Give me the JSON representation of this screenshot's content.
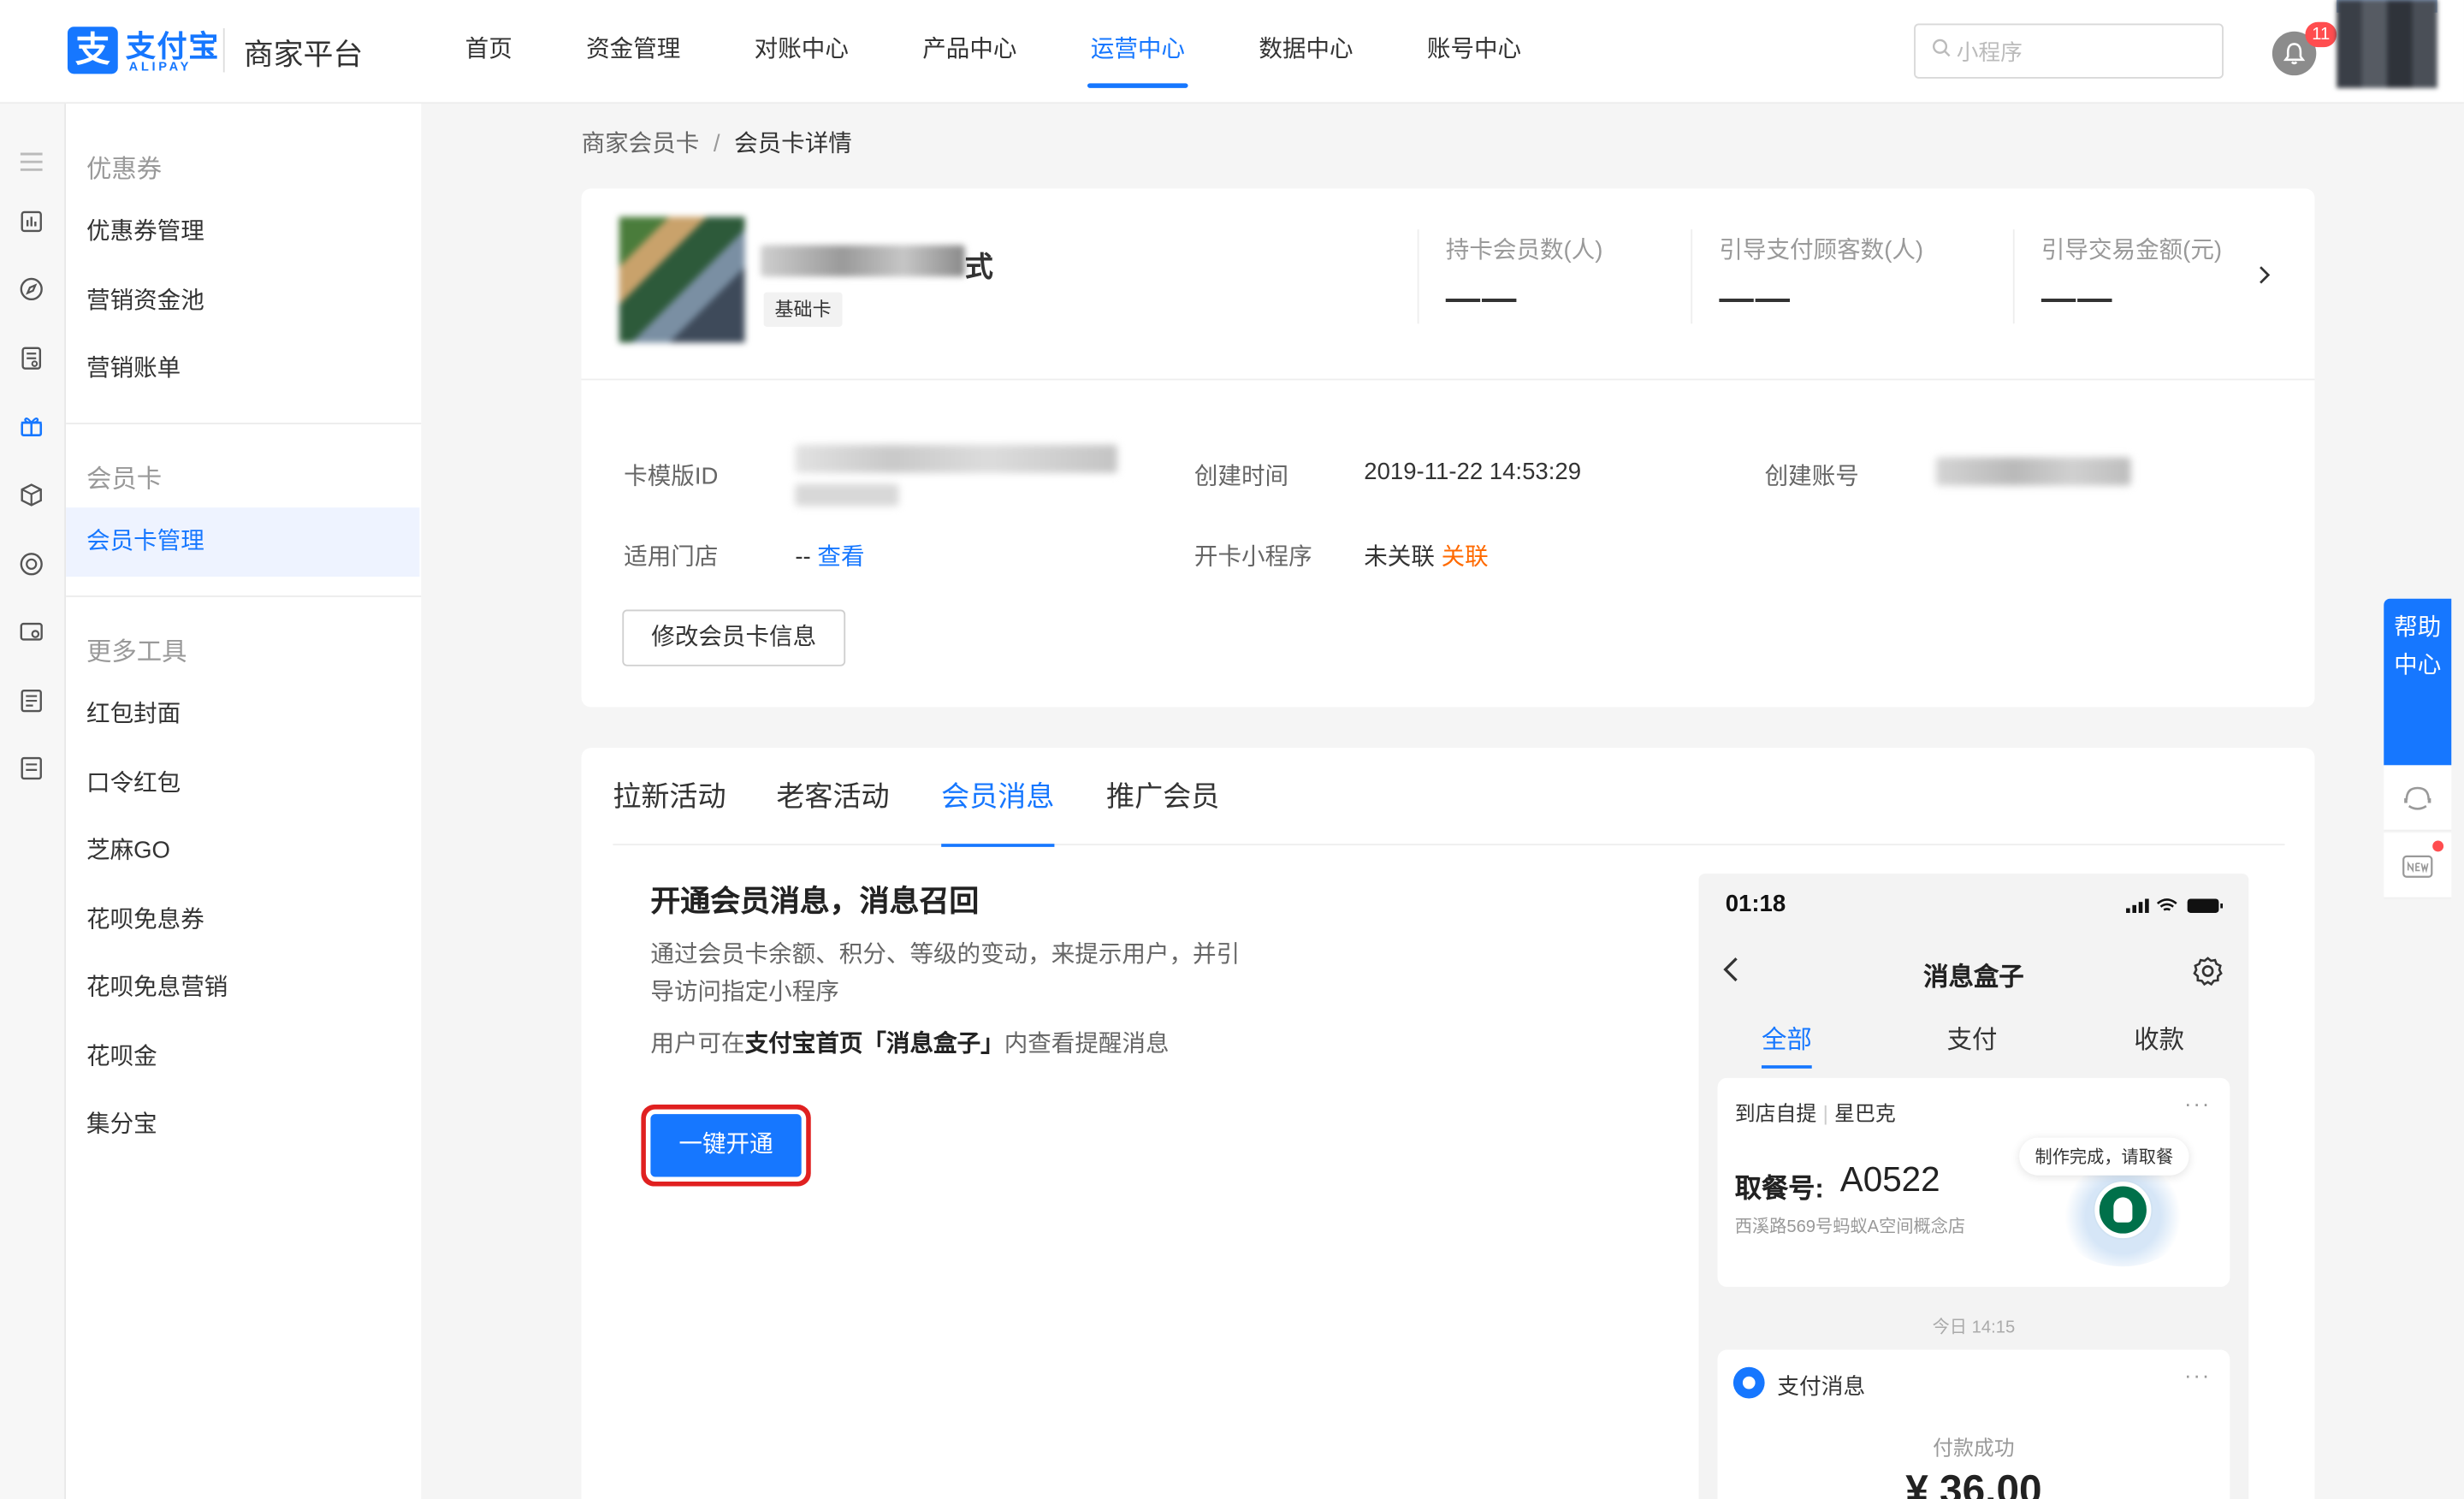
{
  "header": {
    "logo_mark": "支",
    "logo_cn": "支付宝",
    "logo_en": "ALIPAY",
    "platform": "商家平台",
    "nav": [
      "首页",
      "资金管理",
      "对账中心",
      "产品中心",
      "运营中心",
      "数据中心",
      "账号中心"
    ],
    "active_nav_index": 4,
    "search_placeholder": "小程序",
    "notification_count": "11",
    "accent_color": "#1677ff"
  },
  "rail_icons": [
    "menu-icon",
    "bar-chart-icon",
    "compass-icon",
    "document-icon",
    "gift-icon",
    "cube-icon",
    "coin-icon",
    "wallet-icon",
    "list-icon",
    "notes-icon"
  ],
  "sidebar": {
    "group1": "优惠券",
    "group1_items": [
      "优惠券管理",
      "营销资金池",
      "营销账单"
    ],
    "group2": "会员卡",
    "group2_items": [
      "会员卡管理"
    ],
    "group3": "更多工具",
    "group3_items": [
      "红包封面",
      "口令红包",
      "芝麻GO",
      "花呗免息券",
      "花呗免息营销",
      "花呗金",
      "集分宝"
    ]
  },
  "breadcrumb": {
    "parent": "商家会员卡",
    "separator": "/",
    "current": "会员卡详情"
  },
  "card": {
    "name_visible_suffix": "式",
    "tag": "基础卡",
    "stats": [
      {
        "label": "持卡会员数(人)",
        "value": "——"
      },
      {
        "label": "引导支付顾客数(人)",
        "value": "——"
      },
      {
        "label": "引导交易金额(元)",
        "value": "——"
      }
    ],
    "fields": {
      "template_id_label": "卡模版ID",
      "created_time_label": "创建时间",
      "created_time_value": "2019-11-22 14:53:29",
      "created_account_label": "创建账号",
      "stores_label": "适用门店",
      "stores_value": "--",
      "stores_link": "查看",
      "miniapp_label": "开卡小程序",
      "miniapp_value": "未关联",
      "miniapp_link": "关联"
    },
    "edit_button": "修改会员卡信息"
  },
  "tabs": {
    "items": [
      "拉新活动",
      "老客活动",
      "会员消息",
      "推广会员"
    ],
    "active_index": 2
  },
  "member_message": {
    "title": "开通会员消息，消息召回",
    "desc": "通过会员卡余额、积分、等级的变动，来提示用户，并引导访问指定小程序",
    "desc2_prefix": "用户可在",
    "desc2_bold": "支付宝首页「消息盒子」",
    "desc2_suffix": "内查看提醒消息",
    "cta_button": "一键开通"
  },
  "phone": {
    "time": "01:18",
    "nav_title": "消息盒子",
    "tabs": [
      "全部",
      "支付",
      "收款"
    ],
    "card1": {
      "category": "到店自提",
      "merchant": "星巴克",
      "bubble": "制作完成，请取餐",
      "pickup_label": "取餐号:",
      "pickup_code": "A0522",
      "address": "西溪路569号蚂蚁A空间概念店"
    },
    "timestamp": "今日 14:15",
    "card2": {
      "title": "支付消息",
      "status": "付款成功",
      "amount": "¥ 36.00"
    }
  },
  "help": {
    "label": "帮助中心"
  }
}
